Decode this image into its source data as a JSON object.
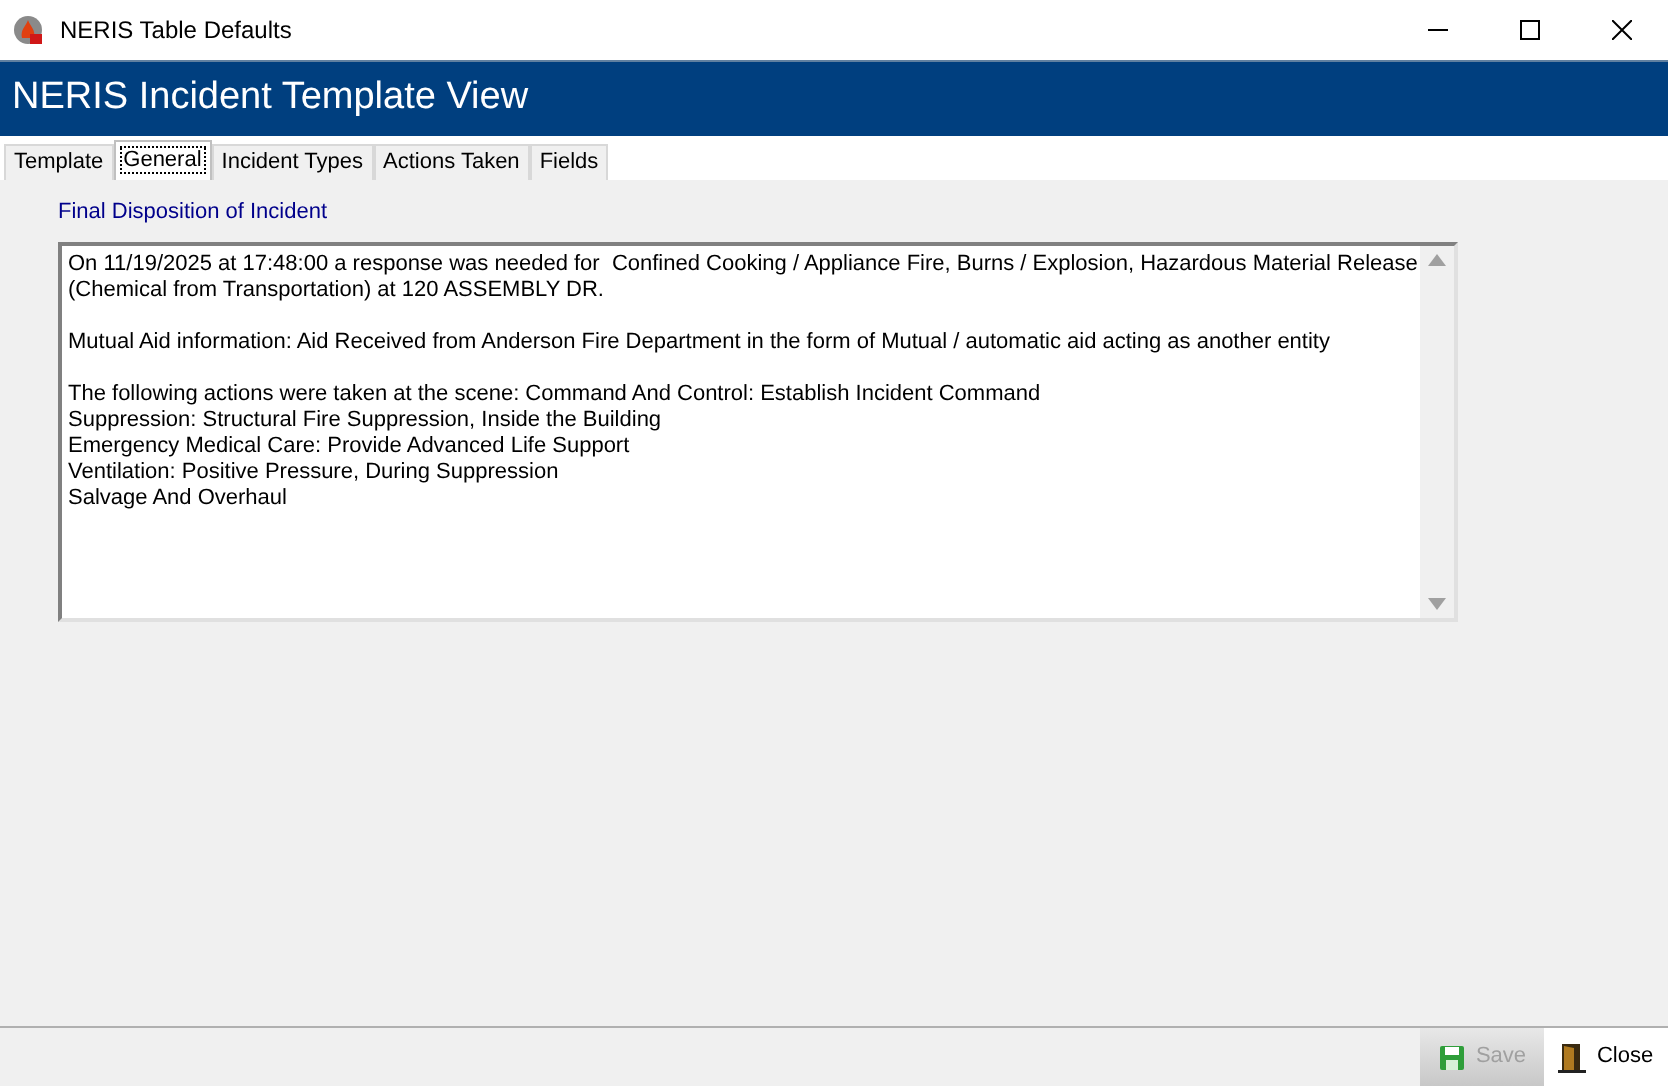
{
  "window": {
    "title": "NERIS Table Defaults"
  },
  "header": {
    "title": "NERIS Incident Template View"
  },
  "tabs": [
    {
      "label": "Template",
      "selected": false
    },
    {
      "label": "General",
      "selected": true
    },
    {
      "label": "Incident Types",
      "selected": false
    },
    {
      "label": "Actions Taken",
      "selected": false
    },
    {
      "label": "Fields",
      "selected": false
    }
  ],
  "section_label": "Final Disposition of Incident",
  "disposition": {
    "paragraphs": [
      [
        "On 11/19/2025 at 17:48:00 a response was needed for  Confined Cooking / Appliance Fire, Burns / Explosion, Hazardous Material Release",
        "(Chemical from Transportation) at 120 ASSEMBLY DR."
      ],
      [
        "Mutual Aid information: Aid Received from Anderson Fire Department in the form of Mutual / automatic aid acting as another entity"
      ],
      [
        "The following actions were taken at the scene: Command And Control: Establish Incident Command",
        "Suppression: Structural Fire Suppression, Inside the Building",
        "Emergency Medical Care: Provide Advanced Life Support",
        "Ventilation: Positive Pressure, During Suppression",
        "Salvage And Overhaul"
      ]
    ]
  },
  "buttons": [
    {
      "label": "Save",
      "disabled": true,
      "kind": "save"
    },
    {
      "label": "Close",
      "disabled": false,
      "kind": "close"
    }
  ]
}
